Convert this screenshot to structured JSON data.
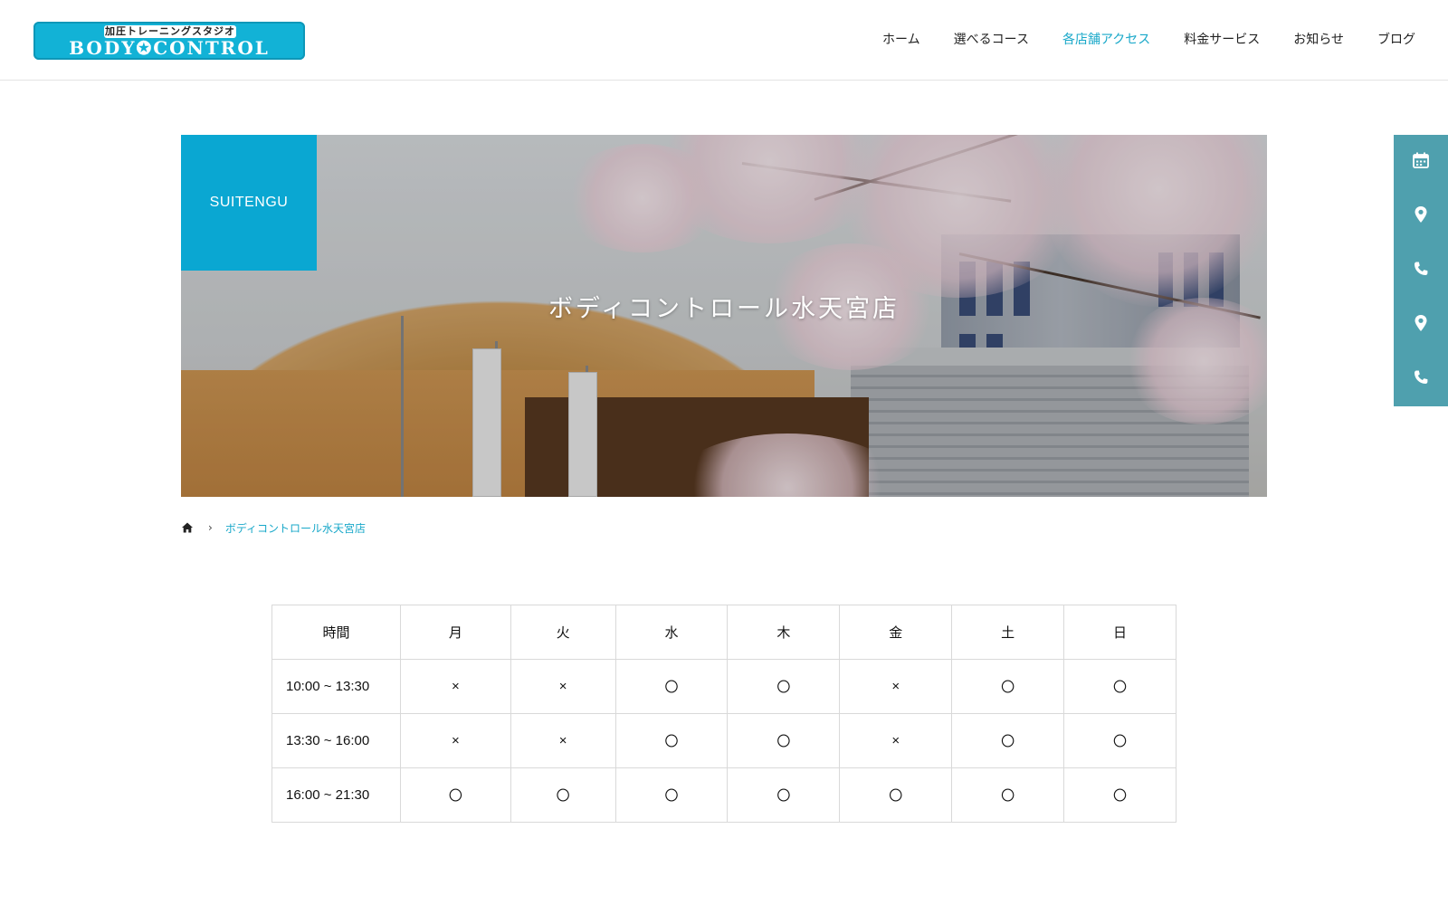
{
  "header": {
    "logo_top": "加圧トレーニングスタジオ",
    "logo_main": "BODY✪CONTROL",
    "nav": [
      {
        "label": "ホーム"
      },
      {
        "label": "選べるコース"
      },
      {
        "label": "各店舗アクセス"
      },
      {
        "label": "料金サービス"
      },
      {
        "label": "お知らせ"
      },
      {
        "label": "ブログ"
      }
    ],
    "accent_color": "#19a8c9"
  },
  "hero": {
    "tag": "SUITENGU",
    "title": "ボディコントロール水天宮店",
    "banner_text": "水天宮"
  },
  "breadcrumb": {
    "current": "ボディコントロール水天宮店",
    "separator": "›"
  },
  "side_rail": {
    "color": "#4fa0ae",
    "icons": [
      "calendar-icon",
      "map-pin-icon",
      "phone-icon",
      "map-pin-icon",
      "phone-icon"
    ]
  },
  "schedule": {
    "headers": [
      "時間",
      "月",
      "火",
      "水",
      "木",
      "金",
      "土",
      "日"
    ],
    "rows": [
      {
        "time": "10:00 ~ 13:30",
        "cells": [
          "×",
          "×",
          "〇",
          "〇",
          "×",
          "〇",
          "〇"
        ]
      },
      {
        "time": "13:30 ~ 16:00",
        "cells": [
          "×",
          "×",
          "〇",
          "〇",
          "×",
          "〇",
          "〇"
        ]
      },
      {
        "time": "16:00 ~ 21:30",
        "cells": [
          "〇",
          "〇",
          "〇",
          "〇",
          "〇",
          "〇",
          "〇"
        ]
      }
    ]
  }
}
